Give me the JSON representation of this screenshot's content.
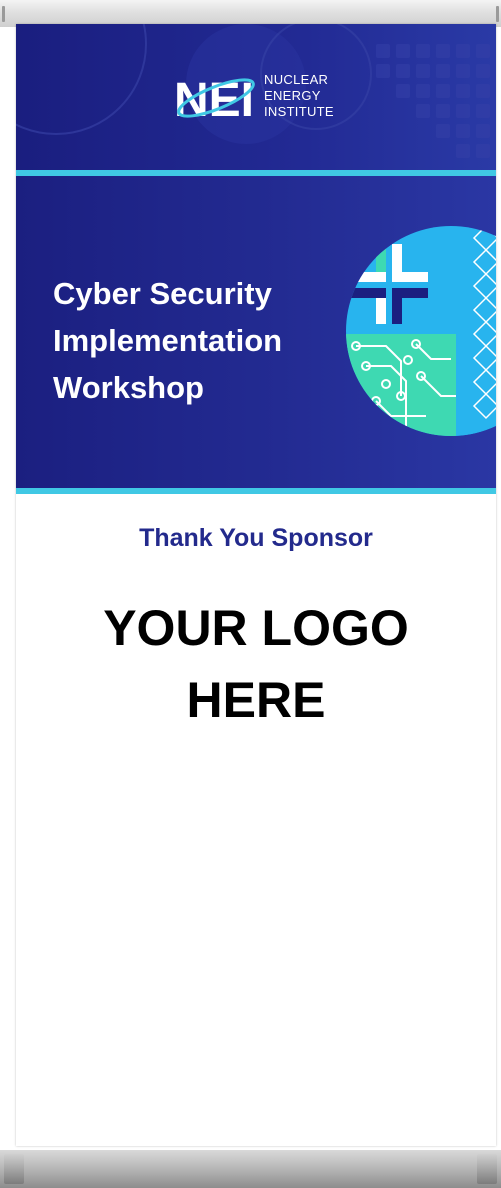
{
  "header": {
    "logo_mark": "NEI",
    "logo_text": [
      "NUCLEAR",
      "ENERGY",
      "INSTITUTE"
    ]
  },
  "hero": {
    "title_lines": [
      "Cyber Security",
      "Implementation",
      "Workshop"
    ]
  },
  "sponsor": {
    "thanks": "Thank You Sponsor",
    "placeholder_lines": [
      "YOUR LOGO",
      "HERE"
    ]
  },
  "colors": {
    "navy": "#1b1f80",
    "accent_cyan": "#40c8e4",
    "sponsor_text": "#232a8c",
    "green": "#40dcb0",
    "light_blue": "#28b4ee"
  }
}
